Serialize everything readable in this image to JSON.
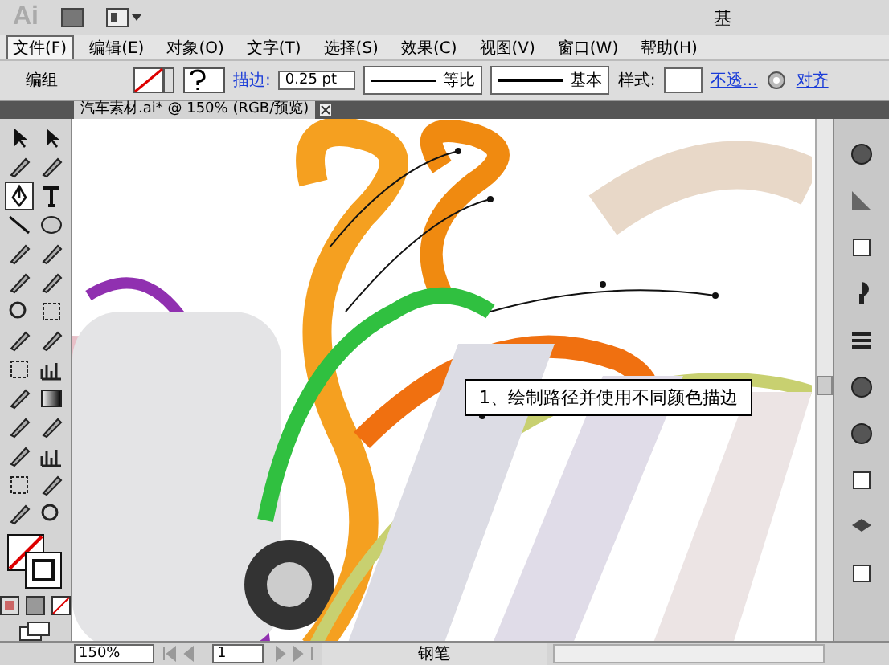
{
  "app": {
    "logo": "Ai",
    "workspace": "基"
  },
  "menu": [
    {
      "label": "文件(F)",
      "selected": true
    },
    {
      "label": "编辑(E)",
      "selected": false
    },
    {
      "label": "对象(O)",
      "selected": false
    },
    {
      "label": "文字(T)",
      "selected": false
    },
    {
      "label": "选择(S)",
      "selected": false
    },
    {
      "label": "效果(C)",
      "selected": false
    },
    {
      "label": "视图(V)",
      "selected": false
    },
    {
      "label": "窗口(W)",
      "selected": false
    },
    {
      "label": "帮助(H)",
      "selected": false
    }
  ],
  "control_bar": {
    "selection": "编组",
    "stroke_label": "描边:",
    "stroke_weight": "0.25 pt",
    "profile": "等比",
    "brush": "基本",
    "style_label": "样式:",
    "opacity_link": "不透...",
    "align_link": "对齐"
  },
  "document_tab": {
    "title": "汽车素材.ai* @ 150% (RGB/预览)"
  },
  "callout": "1、绘制路径并使用不同颜色描边",
  "status_bar": {
    "zoom": "150%",
    "page": "1",
    "tool": "钢笔"
  }
}
